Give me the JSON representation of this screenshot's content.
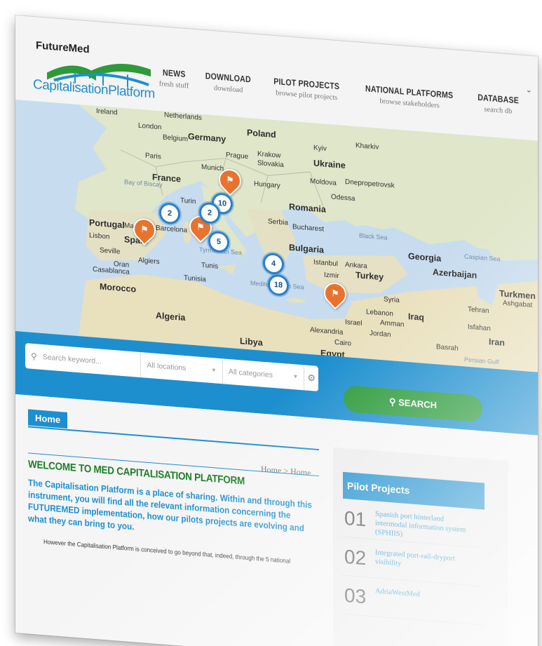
{
  "logo": {
    "top": "FutureMed",
    "bottom": "CapitalisationPlatform"
  },
  "nav": [
    {
      "title": "NEWS",
      "sub": "fresh stuff"
    },
    {
      "title": "DOWNLOAD",
      "sub": "download"
    },
    {
      "title": "PILOT PROJECTS",
      "sub": "browse pilot projects"
    },
    {
      "title": "NATIONAL PLATFORMS",
      "sub": "browse stakeholders"
    },
    {
      "title": "DATABASE",
      "sub": "search db"
    }
  ],
  "map": {
    "labels": {
      "ireland": "Ireland",
      "netherlands": "Netherlands",
      "london": "London",
      "belgium": "Belgium",
      "germany": "Germany",
      "poland": "Poland",
      "paris": "Paris",
      "prague": "Prague",
      "krakow": "Krakow",
      "slovakia": "Slovakia",
      "kyiv": "Kyiv",
      "kharkiv": "Kharkiv",
      "ukraine": "Ukraine",
      "france": "France",
      "munich": "Munich",
      "moldova": "Moldova",
      "dnipro": "Dnepropetrovsk",
      "bay": "Bay of Biscay",
      "hungary": "Hungary",
      "odessa": "Odessa",
      "romania": "Romania",
      "turin": "Turin",
      "serbia": "Serbia",
      "bucharest": "Bucharest",
      "blacksea": "Black Sea",
      "portugal": "Portugal",
      "madrid": "Madrid",
      "spain": "Spain",
      "barcelona": "Barcelona",
      "bulgaria": "Bulgaria",
      "georgia": "Georgia",
      "caspian": "Caspian Sea",
      "lisbon": "Lisbon",
      "seville": "Seville",
      "istanbul": "Istanbul",
      "ankara": "Ankara",
      "azerbaijan": "Azerbaijan",
      "tyrrhenian": "Tyrrhenian Sea",
      "turkey": "Turkey",
      "izmir": "Izmir",
      "algiers": "Algiers",
      "tunis": "Tunis",
      "oran": "Oran",
      "turkmen": "Turkmen",
      "ashgabat": "Ashgabat",
      "casablanca": "Casablanca",
      "tunisia": "Tunisia",
      "medsea": "Mediterranean Sea",
      "syria": "Syria",
      "tehran": "Tehran",
      "morocco": "Morocco",
      "lebanon": "Lebanon",
      "iraq": "Iraq",
      "israel": "Israel",
      "amman": "Amman",
      "jordan": "Jordan",
      "isfahan": "Isfahan",
      "iran": "Iran",
      "algeria": "Algeria",
      "alexandria": "Alexandria",
      "cairo": "Cairo",
      "basrah": "Basrah",
      "libya": "Libya",
      "egypt": "Egypt",
      "persian": "Persian Gulf"
    },
    "clusters": [
      "2",
      "10",
      "2",
      "5",
      "4",
      "18"
    ]
  },
  "search": {
    "keyword_placeholder": "Search keyword...",
    "location": "All locations",
    "category": "All categories",
    "button": "SEARCH"
  },
  "page": {
    "tab": "Home",
    "breadcrumb": "Home  >  Home",
    "welcome": "WELCOME TO MED CAPITALISATION PLATFORM",
    "intro": "The Capitalisation Platform is a place of sharing. Within and through this instrument, you will find all the relevant information concerning the FUTUREMED implementation, how our pilots projects are evolving and what they can bring to you.",
    "more": "However the Capitalisation Platform is conceived to go beyond that, indeed, through the 5 national"
  },
  "sidebar": {
    "title": "Pilot Projects",
    "items": [
      {
        "num": "01",
        "title": "Spanish port hinterland intermodal information system (SPHIIS)"
      },
      {
        "num": "02",
        "title": "Integrated port-rail-dryport visibility"
      },
      {
        "num": "03",
        "title": "AdriaWestMed"
      }
    ]
  }
}
